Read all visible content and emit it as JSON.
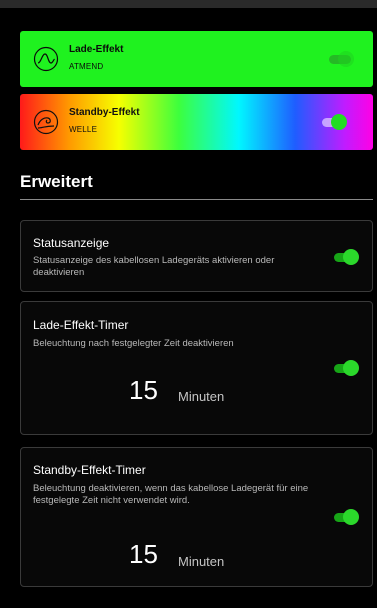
{
  "effects": [
    {
      "title": "Lade-Effekt",
      "mode": "ATMEND",
      "icon": "breathing-wave-icon",
      "color": "#1ff21f"
    },
    {
      "title": "Standby-Effekt",
      "mode": "WELLE",
      "icon": "wave-icon",
      "color": "rainbow"
    }
  ],
  "section": {
    "title": "Erweitert"
  },
  "status": {
    "title": "Statusanzeige",
    "description": "Statusanzeige des kabellosen Ladegeräts aktivieren oder deaktivieren"
  },
  "charge_timer": {
    "title": "Lade-Effekt-Timer",
    "description": "Beleuchtung nach festgelegter Zeit deaktivieren",
    "value": "15",
    "unit": "Minuten"
  },
  "standby_timer": {
    "title": "Standby-Effekt-Timer",
    "description": "Beleuchtung deaktivieren, wenn das kabellose Ladegerät für eine festgelegte Zeit nicht verwendet wird.",
    "value": "15",
    "unit": "Minuten"
  },
  "accent_color": "#22dd22"
}
